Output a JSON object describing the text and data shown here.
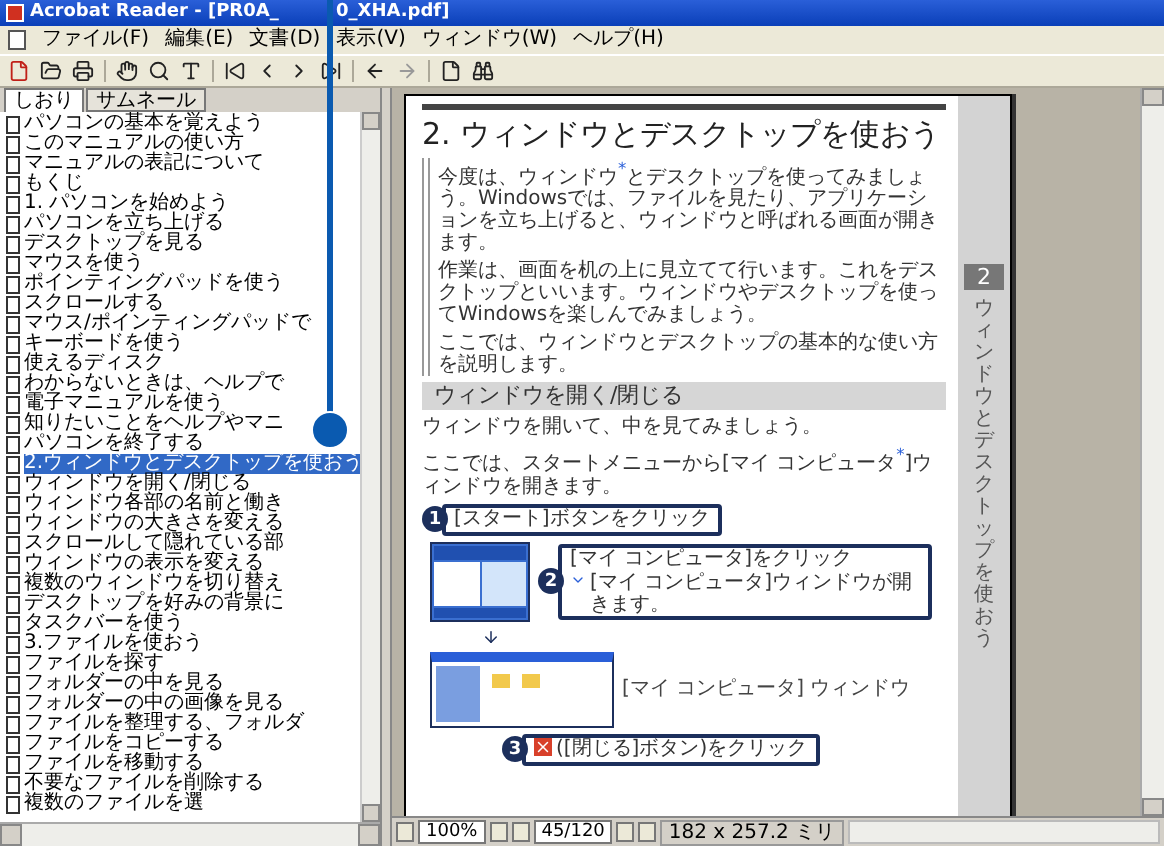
{
  "window": {
    "title": "Acrobat Reader - [PR0A_",
    "title_continued": "0_XHA.pdf]"
  },
  "menu": [
    "ファイル(F)",
    "編集(E)",
    "文書(D)",
    "表示(V)",
    "ウィンドウ(W)",
    "ヘルプ(H)"
  ],
  "sidebar": {
    "tabs": [
      {
        "label": "しおり",
        "selected": true
      },
      {
        "label": "サムネール",
        "selected": false
      }
    ],
    "bookmarks": [
      {
        "label": "パソコンの基本を覚えよう",
        "selected": false
      },
      {
        "label": "このマニュアルの使い方",
        "selected": false
      },
      {
        "label": "マニュアルの表記について",
        "selected": false
      },
      {
        "label": "もくじ",
        "selected": false
      },
      {
        "label": "1. パソコンを始めよう",
        "selected": false
      },
      {
        "label": "パソコンを立ち上げる",
        "selected": false
      },
      {
        "label": "デスクトップを見る",
        "selected": false
      },
      {
        "label": "マウスを使う",
        "selected": false
      },
      {
        "label": "ポインティングパッドを使う",
        "selected": false
      },
      {
        "label": "スクロールする",
        "selected": false
      },
      {
        "label": "マウス/ポインティングパッドで",
        "selected": false
      },
      {
        "label": "キーボードを使う",
        "selected": false
      },
      {
        "label": "使えるディスク",
        "selected": false
      },
      {
        "label": "わからないときは、ヘルプで",
        "selected": false
      },
      {
        "label": "電子マニュアルを使う",
        "selected": false
      },
      {
        "label": "知りたいことをヘルプやマニ",
        "selected": false
      },
      {
        "label": "パソコンを終了する",
        "selected": false
      },
      {
        "label": "2.ウィンドウとデスクトップを使おう",
        "selected": true
      },
      {
        "label": "ウィンドウを開く/閉じる",
        "selected": false
      },
      {
        "label": "ウィンドウ各部の名前と働き",
        "selected": false
      },
      {
        "label": "ウィンドウの大きさを変える",
        "selected": false
      },
      {
        "label": "スクロールして隠れている部",
        "selected": false
      },
      {
        "label": "ウィンドウの表示を変える",
        "selected": false
      },
      {
        "label": "複数のウィンドウを切り替え",
        "selected": false
      },
      {
        "label": "デスクトップを好みの背景に",
        "selected": false
      },
      {
        "label": "タスクバーを使う",
        "selected": false
      },
      {
        "label": "3.ファイルを使おう",
        "selected": false
      },
      {
        "label": "ファイルを探す",
        "selected": false
      },
      {
        "label": "フォルダーの中を見る",
        "selected": false
      },
      {
        "label": "フォルダーの中の画像を見る",
        "selected": false
      },
      {
        "label": "ファイルを整理する、フォルダ",
        "selected": false
      },
      {
        "label": "ファイルをコピーする",
        "selected": false
      },
      {
        "label": "ファイルを移動する",
        "selected": false
      },
      {
        "label": "不要なファイルを削除する",
        "selected": false
      },
      {
        "label": "複数のファイルを選",
        "selected": false
      }
    ]
  },
  "document": {
    "chapter_title": "2. ウィンドウとデスクトップを使おう",
    "intro": [
      "今度は、ウィンドウ$^{*}$とデスクトップを使ってみましょう。Windowsでは、ファイルを見たり、アプリケーションを立ち上げると、ウィンドウと呼ばれる画面が開きます。",
      "作業は、画面を机の上に見立てて行います。これをデスクトップといいます。ウィンドウやデスクトップを使ってWindowsを楽しんでみましょう。",
      "ここでは、ウィンドウとデスクトップの基本的な使い方を説明します。"
    ],
    "side_tab": {
      "number": "2",
      "label": "ウィンドウとデスクトップを使おう"
    },
    "section_heading": "ウィンドウを開く/閉じる",
    "section_text": [
      "ウィンドウを開いて、中を見てみましょう。",
      "ここでは、スタートメニューから[マイ コンピュータ$^{*}$]ウィンドウを開きます。"
    ],
    "steps": [
      {
        "number": "1",
        "text": "[スタート]ボタンをクリック"
      },
      {
        "number": "2",
        "text": "[マイ コンピュータ]をクリック",
        "note": "[マイ コンピュータ]ウィンドウが開きます。"
      },
      {
        "number": "3",
        "text": "([閉じる]ボタン)をクリック"
      }
    ],
    "window_label": "[マイ コンピュータ] ウィンドウ"
  },
  "status_bar": {
    "zoom": "100%",
    "page": "45/120",
    "page_size": "182 x 257.2 ミリ"
  }
}
